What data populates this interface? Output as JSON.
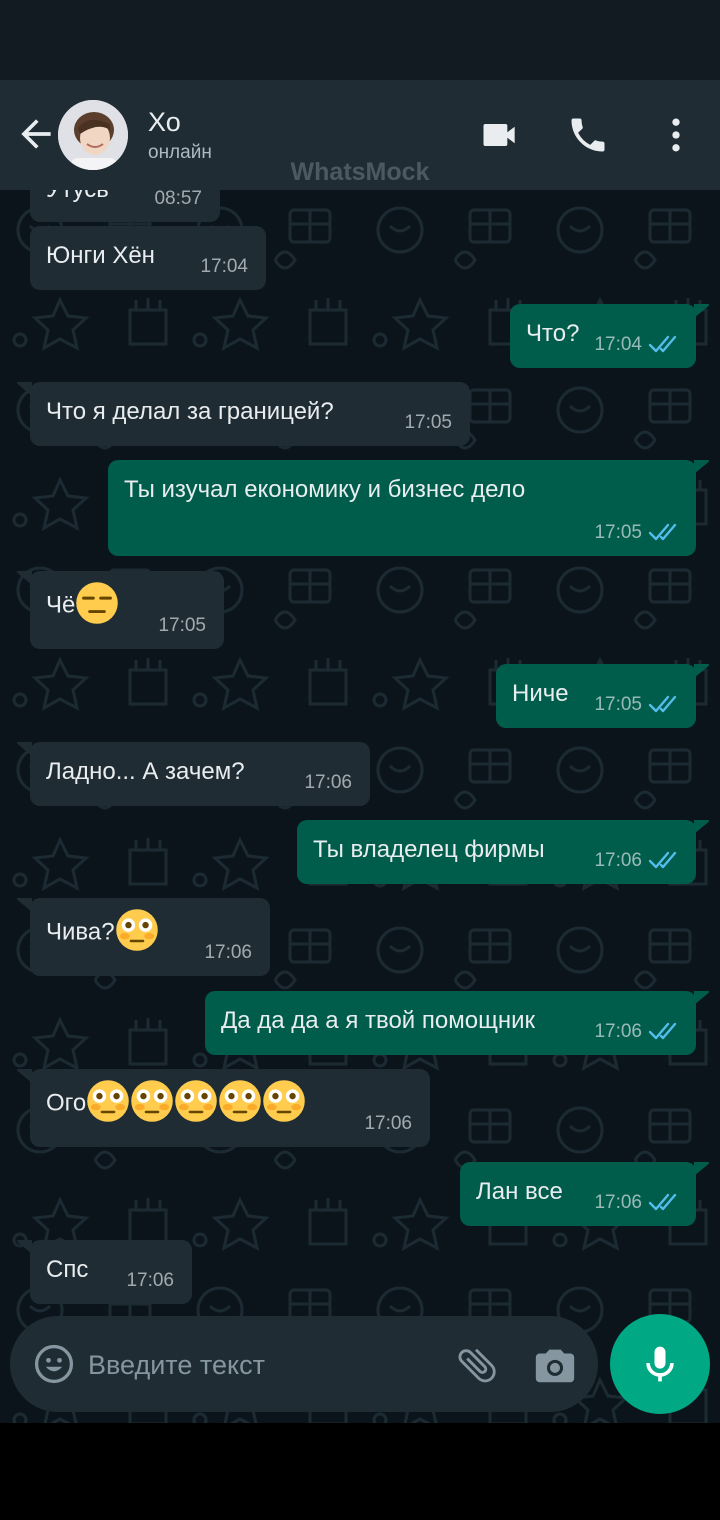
{
  "header": {
    "contact_name": "Хо",
    "contact_status": "онлайн"
  },
  "watermark": "WhatsMock",
  "messages": [
    {
      "dir": "in",
      "text": "Утусь",
      "time": "08:57"
    },
    {
      "dir": "in",
      "text": "Юнги Хён",
      "time": "17:04"
    },
    {
      "dir": "out",
      "text": "Что?",
      "time": "17:04"
    },
    {
      "dir": "in",
      "text": "Что я делал за границей?",
      "time": "17:05"
    },
    {
      "dir": "out",
      "text": "Ты изучал економику и бизнес дело",
      "time": "17:05"
    },
    {
      "dir": "in",
      "text": "Чё",
      "emoji": [
        "expressionless"
      ],
      "time": "17:05"
    },
    {
      "dir": "out",
      "text": "Ниче",
      "time": "17:05"
    },
    {
      "dir": "in",
      "text": "Ладно... А зачем?",
      "time": "17:06"
    },
    {
      "dir": "out",
      "text": "Ты владелец фирмы",
      "time": "17:06"
    },
    {
      "dir": "in",
      "text": "Чива?",
      "emoji": [
        "flushed"
      ],
      "time": "17:06"
    },
    {
      "dir": "out",
      "text": "Да да да а я твой помощник",
      "time": "17:06"
    },
    {
      "dir": "in",
      "text": "Ого",
      "emoji": [
        "flushed",
        "flushed",
        "flushed",
        "flushed",
        "flushed"
      ],
      "time": "17:06"
    },
    {
      "dir": "out",
      "text": "Лан все",
      "time": "17:06"
    },
    {
      "dir": "in",
      "text": "Спс",
      "time": "17:06"
    }
  ],
  "input": {
    "placeholder": "Введите текст"
  },
  "icons": {
    "back": "arrow-left-icon",
    "video_call": "video-camera-icon",
    "voice_call": "phone-icon",
    "menu": "more-vertical-icon",
    "emoji": "emoji-icon",
    "attach": "paperclip-icon",
    "camera": "camera-icon",
    "mic": "microphone-icon",
    "read_receipt": "double-check-icon"
  },
  "colors": {
    "header_bg": "#1f2c34",
    "chat_bg": "#0b141a",
    "incoming_bubble": "#1f2c34",
    "outgoing_bubble": "#005c4b",
    "accent": "#00a884",
    "read_ticks": "#53bdeb"
  }
}
